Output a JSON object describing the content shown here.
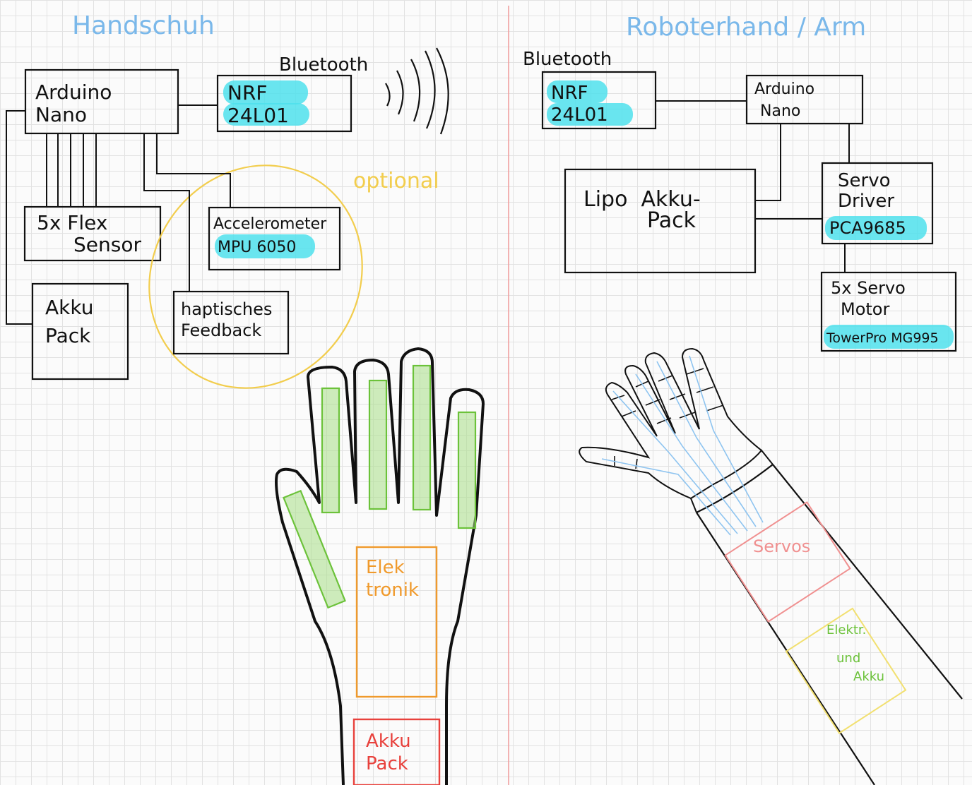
{
  "colors": {
    "heading": "#7ab8ea",
    "ink": "#111111",
    "divider": "#f0a0a0",
    "highlight": "#4fe0ec",
    "optional": "#f2cd4d",
    "flex": "#6cc23a",
    "elektronik": "#f09a2c",
    "akku": "#e8413c",
    "servos_box": "#f09090",
    "tendons": "#8ec4f0",
    "elektr_box": "#f2e070",
    "elektr_text": "#6cc23a"
  },
  "left": {
    "title": "Handschuh",
    "bluetooth": "Bluetooth",
    "arduino": [
      "Arduino",
      "Nano"
    ],
    "nrf": [
      "NRF",
      "24L01"
    ],
    "flex": [
      "5x Flex",
      "Sensor"
    ],
    "akku": [
      "Akku",
      "Pack"
    ],
    "accel": [
      "Accelerometer",
      "MPU 6050"
    ],
    "haptic": [
      "haptisches",
      "Feedback"
    ],
    "optional": "optional",
    "glove_elektronik": [
      "Elek",
      "tronik"
    ],
    "glove_akku": [
      "Akku",
      "Pack"
    ]
  },
  "right": {
    "title": "Roboterhand / Arm",
    "bluetooth": "Bluetooth",
    "nrf": [
      "NRF",
      "24L01"
    ],
    "arduino": [
      "Arduino",
      "Nano"
    ],
    "lipo": [
      "Lipo  Akku-",
      "Pack"
    ],
    "servo_driver": [
      "Servo",
      "Driver",
      "PCA9685"
    ],
    "servo_motor": [
      "5x Servo",
      "Motor",
      "TowerPro MG995"
    ],
    "arm_servos": "Servos",
    "arm_elektr": [
      "Elektr.",
      "und",
      "Akku"
    ]
  }
}
